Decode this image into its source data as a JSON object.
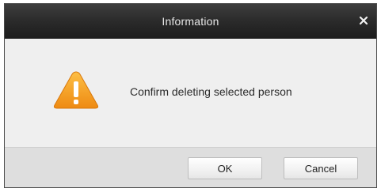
{
  "dialog": {
    "title": "Information",
    "close_icon": "close-icon",
    "message": "Confirm deleting selected person",
    "icon": "warning-icon",
    "buttons": {
      "ok_label": "OK",
      "cancel_label": "Cancel"
    }
  },
  "colors": {
    "titlebar": "#2c2c2c",
    "title_text": "#e8e8e8",
    "warning_orange": "#f39a1f",
    "body_bg": "#efefef",
    "footer_bg": "#dedede"
  }
}
